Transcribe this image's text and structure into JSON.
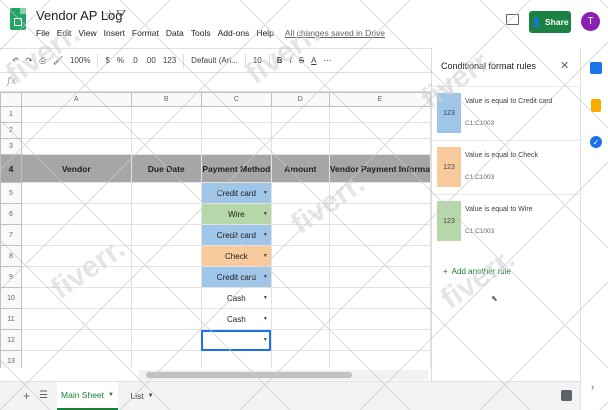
{
  "app": {
    "title": "Vendor AP Log",
    "menu": [
      "File",
      "Edit",
      "View",
      "Insert",
      "Format",
      "Data",
      "Tools",
      "Add-ons",
      "Help"
    ],
    "save_status": "All changes saved in Drive",
    "share_label": "Share",
    "avatar_letter": "T"
  },
  "toolbar": {
    "zoom": "100%",
    "currency": "$",
    "percent": "%",
    "decimal_dec": ".0",
    "decimal_inc": ".00",
    "format_more": "123",
    "font": "Default (Ari...",
    "font_size": "10",
    "bold": "B",
    "italic": "I",
    "strike": "S",
    "text_color": "A"
  },
  "formula_bar": {
    "label": "fx",
    "value": ""
  },
  "grid": {
    "columns": [
      "A",
      "B",
      "C",
      "D",
      "E"
    ],
    "rows": [
      "1",
      "2",
      "3",
      "4",
      "5",
      "6",
      "7",
      "8",
      "9",
      "10",
      "11",
      "12",
      "13"
    ],
    "headers": [
      "Vendor",
      "Due Date",
      "Payment Method",
      "Amount",
      "Vendor Payment Informa"
    ],
    "payment_methods": [
      {
        "text": "Credit card",
        "color": "#9fc5e8"
      },
      {
        "text": "Wire",
        "color": "#b6d7a8"
      },
      {
        "text": "Credit card",
        "color": "#9fc5e8"
      },
      {
        "text": "Check",
        "color": "#f9cb9c"
      },
      {
        "text": "Credit card",
        "color": "#9fc5e8"
      },
      {
        "text": "Cash",
        "color": ""
      },
      {
        "text": "Cash",
        "color": ""
      },
      {
        "text": "",
        "color": ""
      }
    ]
  },
  "sheets": {
    "tabs": [
      {
        "label": "Main Sheet",
        "active": true
      },
      {
        "label": "List",
        "active": false
      }
    ]
  },
  "panel": {
    "title": "Conditional format rules",
    "rules": [
      {
        "preview": "123",
        "condition": "Value is equal to Credit card",
        "range": "C1:C1003",
        "color": "#9fc5e8"
      },
      {
        "preview": "123",
        "condition": "Value is equal to Check",
        "range": "C1:C1003",
        "color": "#f9cb9c"
      },
      {
        "preview": "123",
        "condition": "Value is equal to Wire",
        "range": "C1:C1003",
        "color": "#b6d7a8"
      }
    ],
    "add_rule": "Add another rule"
  },
  "watermark_text": "fiverr."
}
